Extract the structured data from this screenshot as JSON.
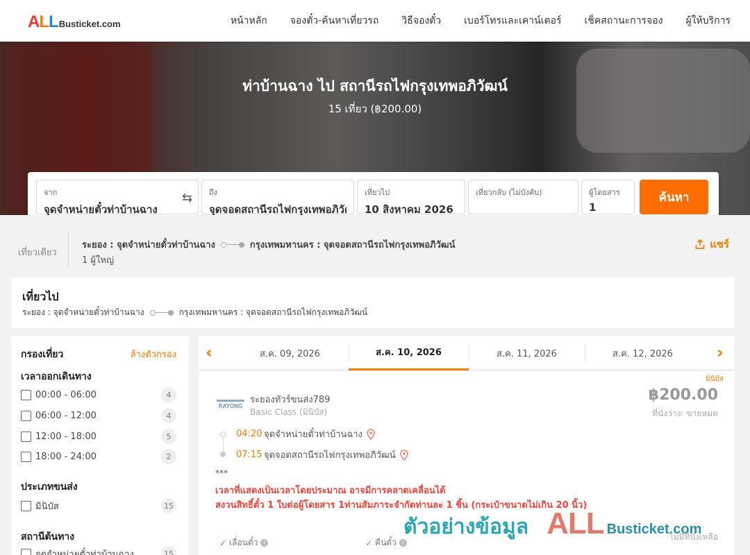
{
  "header": {
    "logo_all": "ALL",
    "logo_rest": "Busticket.com",
    "nav": [
      "หน้าหลัก",
      "จองตั๋ว-ค้นหาเที่ยวรถ",
      "วิธีจองตั๋ว",
      "เบอร์โทรและเคาน์เตอร์",
      "เช็คสถานะการจอง",
      "ผู้ให้บริการ"
    ]
  },
  "hero": {
    "title": "ท่าบ้านฉาง ไป สถานีรถไฟกรุงเทพอภิวัฒน์",
    "subtitle": "15 เที่ยว (฿200.00)"
  },
  "search": {
    "from_label": "จาก",
    "from_value": "จุดจำหน่ายตั๋วท่าบ้านฉาง",
    "to_label": "ถึง",
    "to_value": "จุดจอดสถานีรถไฟกรุงเทพอภิวัฒน์",
    "depart_label": "เที่ยวไป",
    "depart_value": "10 สิงหาคม 2026",
    "return_label": "เที่ยวกลับ (ไม่บังคับ)",
    "return_value": "",
    "pax_label": "ผู้โดยสาร",
    "pax_value": "1",
    "button": "ค้นหา"
  },
  "trip": {
    "type": "เที่ยวเดียว",
    "origin": "ระยอง : จุดจำหน่ายตั๋วท่าบ้านฉาง",
    "destination": "กรุงเทพมหานคร : จุดจอดสถานีรถไฟกรุงเทพอภิวัฒน์",
    "passengers": "1 ผู้ใหญ่",
    "share": "แชร์"
  },
  "outbound": {
    "title": "เที่ยวไป",
    "origin": "ระยอง : จุดจำหน่ายตั๋วท่าบ้านฉาง",
    "destination": "กรุงเทพมหานคร : จุดจอดสถานีรถไฟกรุงเทพอภิวัฒน์"
  },
  "filters": {
    "title": "กรองเที่ยว",
    "clear": "ล้างตัวกรอง",
    "departure_title": "เวลาออกเดินทาง",
    "departure_times": [
      {
        "label": "00:00 - 06:00",
        "count": "4"
      },
      {
        "label": "06:00 - 12:00",
        "count": "4"
      },
      {
        "label": "12:00 - 18:00",
        "count": "5"
      },
      {
        "label": "18:00 - 24:00",
        "count": "2"
      }
    ],
    "vehicle_title": "ประเภทขนส่ง",
    "vehicle_types": [
      {
        "label": "มินิบัส",
        "count": "15"
      }
    ],
    "origin_title": "สถานีต้นทาง",
    "origin_stations": [
      {
        "label": "จุดจำหน่ายตั๋วท่าบ้านฉาง",
        "count": "15"
      }
    ]
  },
  "dates": [
    "ส.ค. 09, 2026",
    "ส.ค. 10, 2026",
    "ส.ค. 11, 2026",
    "ส.ค. 12, 2026"
  ],
  "active_date_index": 1,
  "result": {
    "badge": "มินิบัส",
    "operator": "ระยองทัวร์ขนส่ง789",
    "operator_logo_text": "RAYONG",
    "bus_class": "Basic Class (มินิบัส)",
    "price": "฿200.00",
    "seats": "ที่นั่งว่าง: ขายหมด",
    "depart_time": "04:20",
    "depart_stop": "จุดจำหน่ายตั๋วท่าบ้านฉาง",
    "arrive_time": "07:15",
    "arrive_stop": "จุดจอดสถานีรถไฟกรุงเทพอภิวัฒน์",
    "stars": "***",
    "notice_1": "เวลาที่แสดงเป็นเวลาโดยประมาณ อาจมีการคลาดเคลื่อนได้",
    "notice_2": "สงวนสิทธิ์ตั๋ว 1 ใบต่อผู้โดยสาร 1ท่านสัมภาระจำกัดท่านละ 1 ชิ้น (กระเป๋าขนาดไม่เกิน 20 นิ้ว)",
    "feature_1": "เลื่อนตั๋ว",
    "feature_2": "คืนตั๋ว",
    "no_seats": "ไม่มีที่นั่งเหลือ"
  },
  "watermark": {
    "thai": "ตัวอย่างข้อมูล",
    "all": "ALL",
    "rest": "Busticket.com"
  },
  "colors": {
    "accent": "#ff6d00",
    "notice": "#e8453c"
  }
}
